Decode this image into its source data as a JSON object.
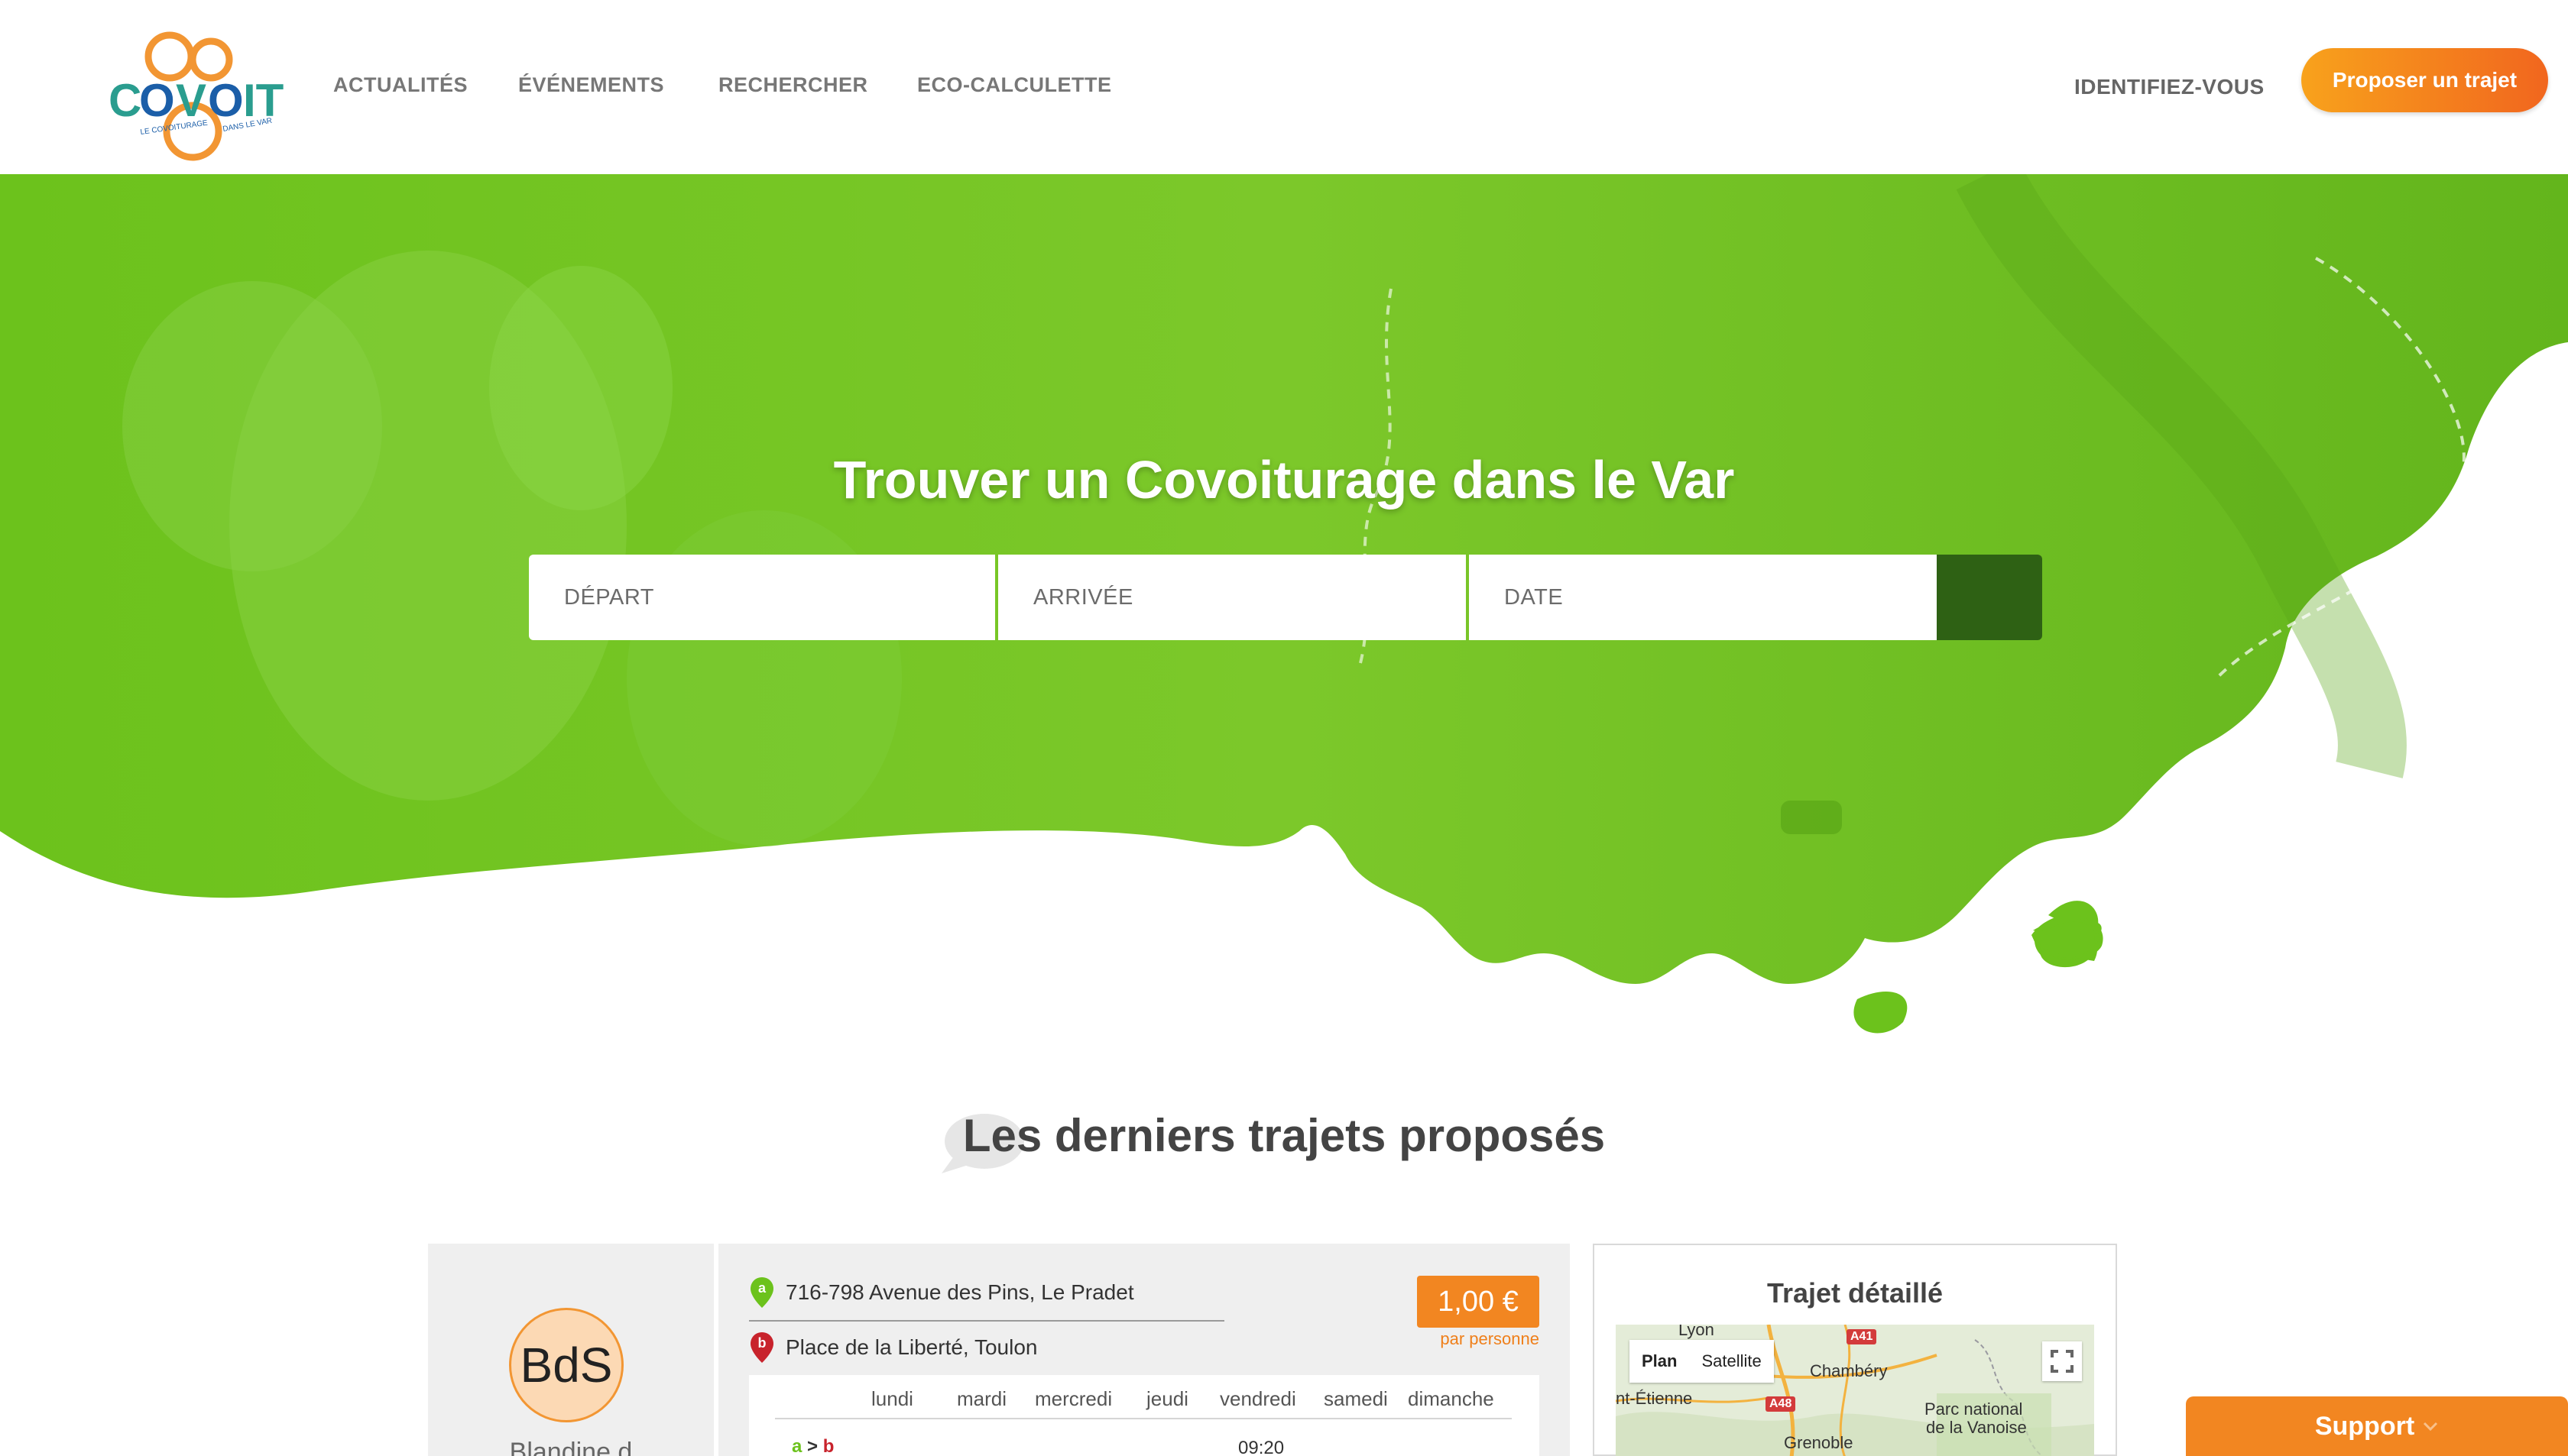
{
  "header": {
    "logo_text": "COVOIT",
    "logo_tagline": "LE COVOITURAGE DANS LE VAR",
    "nav": [
      "ACTUALITÉS",
      "ÉVÉNEMENTS",
      "RECHERCHER",
      "ECO-CALCULETTE"
    ],
    "login_label": "IDENTIFIEZ-VOUS",
    "propose_label": "Proposer un trajet"
  },
  "hero": {
    "title": "Trouver un Covoiturage dans le Var",
    "search": {
      "depart_placeholder": "DÉPART",
      "arrivee_placeholder": "ARRIVÉE",
      "date_placeholder": "DATE"
    }
  },
  "latest": {
    "title": "Les derniers trajets proposés",
    "trip": {
      "driver_initials": "BdS",
      "driver_name": "Blandine d",
      "from_marker": "a",
      "to_marker": "b",
      "from": "716-798 Avenue des Pins, Le Pradet",
      "to": "Place de la Liberté, Toulon",
      "price": "1,00 €",
      "price_sub": "par personne",
      "days": [
        "lundi",
        "mardi",
        "mercredi",
        "jeudi",
        "vendredi",
        "samedi",
        "dimanche"
      ],
      "route_a": "a",
      "route_sep": ">",
      "route_b": "b",
      "time": "09:20"
    },
    "map": {
      "title": "Trajet détaillé",
      "opt_plan": "Plan",
      "opt_satellite": "Satellite",
      "labels": [
        "Lyon",
        "Chambéry",
        "nt-Étienne",
        "Grenoble",
        "Parc national",
        "de la Vanoise"
      ],
      "roads": [
        "A41",
        "A48"
      ]
    }
  },
  "support_label": "Support"
}
